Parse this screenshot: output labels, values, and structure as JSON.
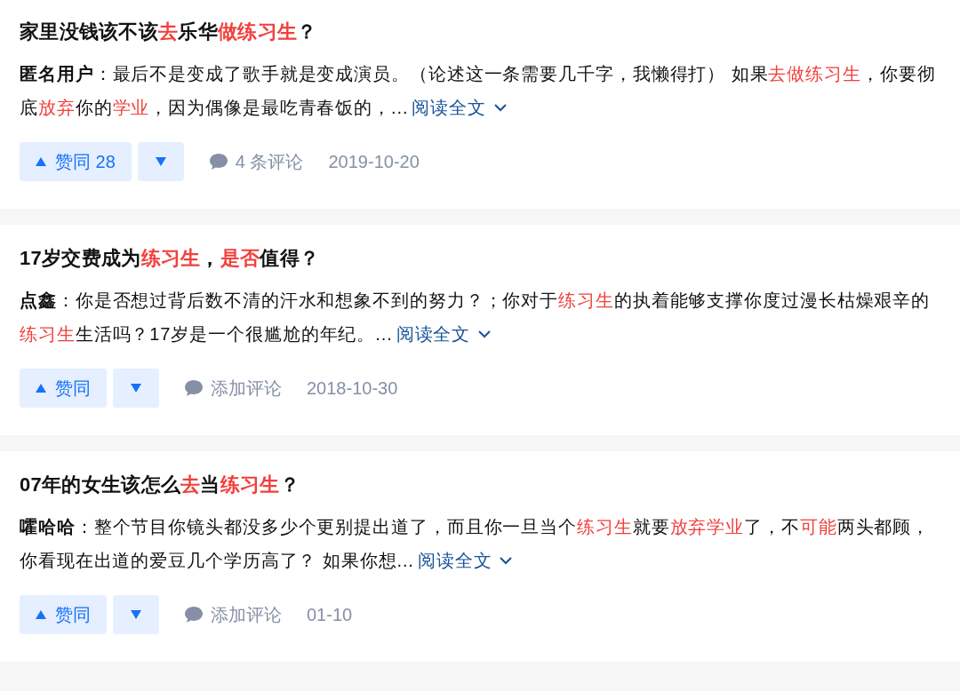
{
  "answers": [
    {
      "title": [
        {
          "text": "家里没钱该不该",
          "highlight": false
        },
        {
          "text": "去",
          "highlight": true
        },
        {
          "text": "乐华",
          "highlight": false
        },
        {
          "text": "做练习生",
          "highlight": true
        },
        {
          "text": "？",
          "highlight": false
        }
      ],
      "excerpt": [
        {
          "kind": "author",
          "text": "匿名用户"
        },
        {
          "kind": "plain",
          "text": "：最后不是变成了歌手就是变成演员。（论述这一条需要几千字，我懒得打） 如果"
        },
        {
          "kind": "highlight",
          "text": "去做练习生"
        },
        {
          "kind": "plain",
          "text": "，你要彻底"
        },
        {
          "kind": "highlight",
          "text": "放弃"
        },
        {
          "kind": "plain",
          "text": "你的"
        },
        {
          "kind": "highlight",
          "text": "学业"
        },
        {
          "kind": "plain",
          "text": "，因为偶像是最吃青春饭的，..."
        }
      ],
      "read_more": "阅读全文",
      "vote_label": "赞同 28",
      "comments": "4 条评论",
      "date": "2019-10-20"
    },
    {
      "title": [
        {
          "text": "17岁交费成为",
          "highlight": false
        },
        {
          "text": "练习生",
          "highlight": true
        },
        {
          "text": "，",
          "highlight": false
        },
        {
          "text": "是否",
          "highlight": true
        },
        {
          "text": "值得？",
          "highlight": false
        }
      ],
      "excerpt": [
        {
          "kind": "author",
          "text": "点鑫"
        },
        {
          "kind": "plain",
          "text": "：你是否想过背后数不清的汗水和想象不到的努力？；你对于"
        },
        {
          "kind": "highlight",
          "text": "练习生"
        },
        {
          "kind": "plain",
          "text": "的执着能够支撑你度过漫长枯燥艰辛的"
        },
        {
          "kind": "highlight",
          "text": "练习生"
        },
        {
          "kind": "plain",
          "text": "生活吗？17岁是一个很尴尬的年纪。..."
        }
      ],
      "read_more": "阅读全文",
      "vote_label": "赞同",
      "comments": "添加评论",
      "date": "2018-10-30"
    },
    {
      "title": [
        {
          "text": "07年的女生该怎么",
          "highlight": false
        },
        {
          "text": "去",
          "highlight": true
        },
        {
          "text": "当",
          "highlight": false
        },
        {
          "text": "练习生",
          "highlight": true
        },
        {
          "text": "？",
          "highlight": false
        }
      ],
      "excerpt": [
        {
          "kind": "author",
          "text": "嚯哈哈"
        },
        {
          "kind": "plain",
          "text": "：整个节目你镜头都没多少个更别提出道了，而且你一旦当个"
        },
        {
          "kind": "highlight",
          "text": "练习生"
        },
        {
          "kind": "plain",
          "text": "就要"
        },
        {
          "kind": "highlight",
          "text": "放弃学业"
        },
        {
          "kind": "plain",
          "text": "了，不"
        },
        {
          "kind": "highlight",
          "text": "可能"
        },
        {
          "kind": "plain",
          "text": "两头都顾，你看现在出道的爱豆几个学历高了？ 如果你想..."
        }
      ],
      "read_more": "阅读全文",
      "vote_label": "赞同",
      "comments": "添加评论",
      "date": "01-10"
    }
  ]
}
